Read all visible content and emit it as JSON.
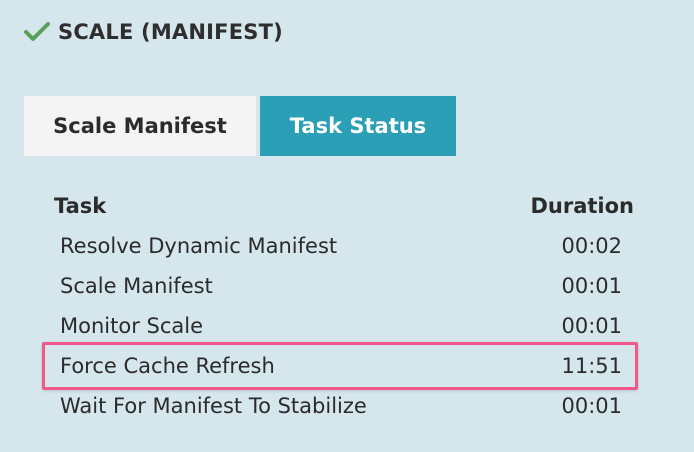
{
  "stage": {
    "status_icon": "check-icon",
    "status_color": "#5aa05a",
    "title": "SCALE (MANIFEST)"
  },
  "tabs": [
    {
      "label": "Scale Manifest",
      "active": false
    },
    {
      "label": "Task Status",
      "active": true
    }
  ],
  "accent_color": "#2a9fb6",
  "highlight_color": "#f0578a",
  "table": {
    "headers": {
      "task": "Task",
      "duration": "Duration"
    },
    "rows": [
      {
        "task": "Resolve Dynamic Manifest",
        "duration": "00:02"
      },
      {
        "task": "Scale Manifest",
        "duration": "00:01"
      },
      {
        "task": "Monitor Scale",
        "duration": "00:01"
      },
      {
        "task": "Force Cache Refresh",
        "duration": "11:51",
        "highlighted": true
      },
      {
        "task": "Wait For Manifest To Stabilize",
        "duration": "00:01"
      }
    ]
  }
}
